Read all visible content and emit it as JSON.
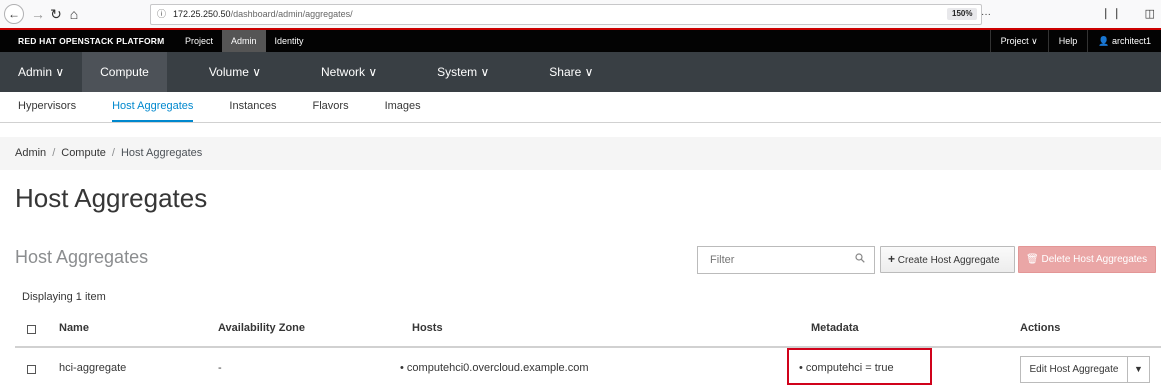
{
  "browser": {
    "url_host": "172.25.250.50",
    "url_path": "/dashboard/admin/aggregates/",
    "zoom": "150%",
    "more_icon": "···",
    "pocket_icon": "pocket-icon",
    "bookmark_icon": "star-icon"
  },
  "topbar": {
    "brand": "RED HAT OPENSTACK PLATFORM",
    "tabs": [
      "Project",
      "Admin",
      "Identity"
    ],
    "project_menu": "Project ∨",
    "help": "Help",
    "user": "architect1"
  },
  "navbar": {
    "items": [
      "Admin ∨",
      "Compute",
      "Volume ∨",
      "Network ∨",
      "System ∨",
      "Share ∨"
    ]
  },
  "subtabs": [
    "Hypervisors",
    "Host Aggregates",
    "Instances",
    "Flavors",
    "Images"
  ],
  "breadcrumb": {
    "items": [
      "Admin",
      "Compute",
      "Host Aggregates"
    ]
  },
  "page": {
    "title": "Host Aggregates",
    "section_title": "Host Aggregates",
    "filter_placeholder": "Filter",
    "create_button": "Create Host Aggregate",
    "delete_button": "Delete Host Aggregates",
    "count_text": "Displaying 1 item"
  },
  "table": {
    "headers": [
      "Name",
      "Availability Zone",
      "Hosts",
      "Metadata",
      "Actions"
    ],
    "rows": [
      {
        "name": "hci-aggregate",
        "availability_zone": "-",
        "hosts": "computehci0.overcloud.example.com",
        "metadata": "computehci = true",
        "action": "Edit Host Aggregate"
      }
    ]
  },
  "colors": {
    "brand_red": "#cc0000",
    "nav_bg": "#393f44",
    "accent": "#0088ce",
    "highlight": "#d0021b"
  }
}
